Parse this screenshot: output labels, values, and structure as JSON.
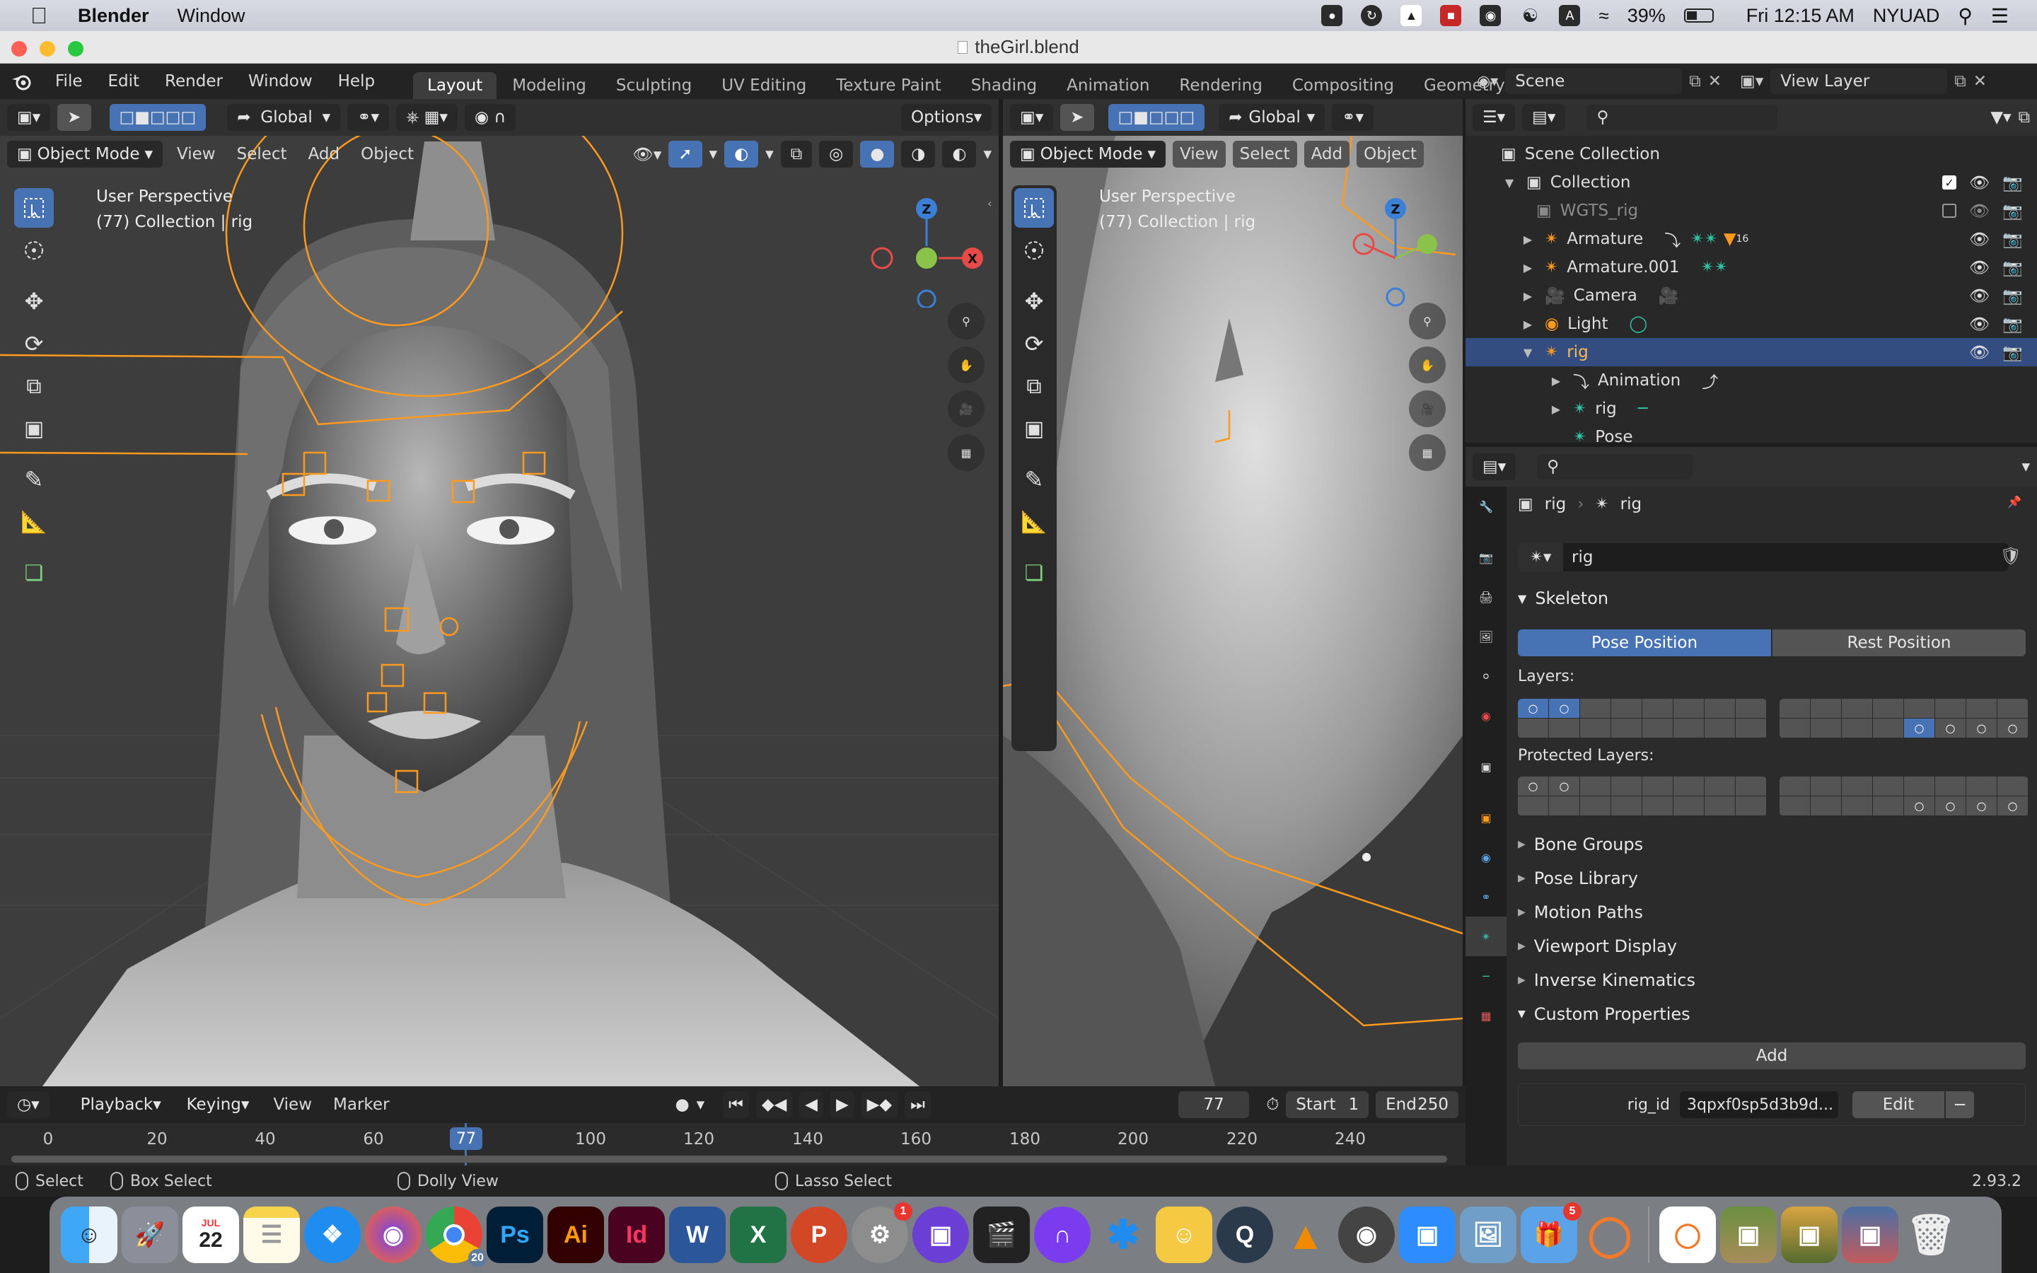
{
  "macos": {
    "app": "Blender",
    "menu": [
      "Window"
    ],
    "battery": "39%",
    "clock": "Fri 12:15 AM",
    "user": "NYUAD"
  },
  "window": {
    "title": "theGirl.blend"
  },
  "topbar": {
    "menus": [
      "File",
      "Edit",
      "Render",
      "Window",
      "Help"
    ],
    "workspaces": [
      "Layout",
      "Modeling",
      "Sculpting",
      "UV Editing",
      "Texture Paint",
      "Shading",
      "Animation",
      "Rendering",
      "Compositing",
      "Geometry Nodes"
    ],
    "active_workspace": "Layout",
    "scene": "Scene",
    "view_layer": "View Layer"
  },
  "viewport_left": {
    "transform": "Global",
    "options": "Options",
    "mode": "Object Mode",
    "menus": [
      "View",
      "Select",
      "Add",
      "Object"
    ],
    "overlay_title": "User Perspective",
    "overlay_sub": "(77) Collection | rig",
    "gizmo": {
      "z": "Z",
      "x": "X"
    }
  },
  "viewport_right": {
    "transform": "Global",
    "mode": "Object Mode",
    "menus": [
      "View",
      "Select",
      "Add",
      "Object"
    ],
    "overlay_title": "User Perspective",
    "overlay_sub": "(77) Collection | rig",
    "gizmo": {
      "z": "Z"
    }
  },
  "outliner": {
    "rows": [
      {
        "label": "Scene Collection",
        "indent": 0
      },
      {
        "label": "Collection",
        "indent": 1
      },
      {
        "label": "WGTS_rig",
        "indent": 2
      },
      {
        "label": "Armature",
        "indent": 2
      },
      {
        "label": "Armature.001",
        "indent": 2
      },
      {
        "label": "Camera",
        "indent": 2
      },
      {
        "label": "Light",
        "indent": 2
      },
      {
        "label": "rig",
        "indent": 2
      },
      {
        "label": "Animation",
        "indent": 3
      },
      {
        "label": "rig",
        "indent": 3
      },
      {
        "label": "Pose",
        "indent": 3
      }
    ],
    "armature_badge": "16"
  },
  "properties": {
    "breadcrumb_object": "rig",
    "breadcrumb_data": "rig",
    "data_name": "rig",
    "skeleton_title": "Skeleton",
    "pose_position": "Pose Position",
    "rest_position": "Rest Position",
    "layers_label": "Layers:",
    "protected_layers_label": "Protected Layers:",
    "collapsed_panels": [
      "Bone Groups",
      "Pose Library",
      "Motion Paths",
      "Viewport Display",
      "Inverse Kinematics"
    ],
    "custom_props_title": "Custom Properties",
    "add_label": "Add",
    "prop_name": "rig_id",
    "prop_value": "3qpxf0sp5d3b9d...",
    "edit_label": "Edit",
    "minus_label": "−"
  },
  "timeline": {
    "menus": [
      "Playback",
      "Keying",
      "View",
      "Marker"
    ],
    "current_frame": "77",
    "start_label": "Start",
    "start": "1",
    "end_label": "End",
    "end": "250",
    "ticks": [
      "0",
      "20",
      "40",
      "60",
      "100",
      "120",
      "140",
      "160",
      "180",
      "200",
      "220",
      "240"
    ],
    "playhead": "77"
  },
  "statusbar": {
    "select": "Select",
    "box_select": "Box Select",
    "dolly_view": "Dolly View",
    "lasso_select": "Lasso Select",
    "version": "2.93.2"
  },
  "dock": {
    "calendar_month": "JUL",
    "calendar_day": "22",
    "chrome_badge": "20",
    "prefs_badge": "1",
    "installer_badge": "5"
  },
  "colors": {
    "accent": "#4772b3",
    "selection": "#334d80",
    "rig_outline": "#ff9a1f"
  }
}
